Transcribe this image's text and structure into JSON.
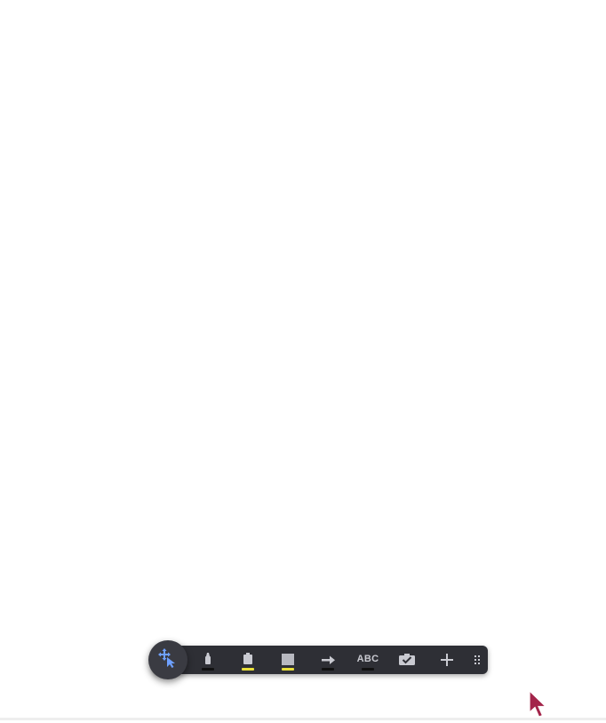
{
  "toolbar": {
    "tools": [
      {
        "name": "select-move",
        "icon": "move-pointer-icon",
        "active": true
      },
      {
        "name": "marker",
        "icon": "marker-icon",
        "underline_color": "#111111"
      },
      {
        "name": "highlighter",
        "icon": "highlighter-icon",
        "underline_color": "#e8df3a"
      },
      {
        "name": "rectangle",
        "icon": "rectangle-icon",
        "underline_color": "#e8df3a"
      },
      {
        "name": "arrow",
        "icon": "arrow-icon",
        "underline_color": "#111111"
      },
      {
        "name": "text",
        "label": "ABC",
        "underline_color": "#111111"
      },
      {
        "name": "stamp",
        "icon": "checkmark-stamp-icon"
      },
      {
        "name": "add",
        "icon": "plus-icon"
      },
      {
        "name": "drag-handle",
        "icon": "grip-dots-icon"
      }
    ]
  },
  "colors": {
    "toolbar_bg": "#2e2f35",
    "active_accent": "#6ea0ff",
    "icon_color": "#c9cad1",
    "cursor_color": "#a3244a"
  }
}
